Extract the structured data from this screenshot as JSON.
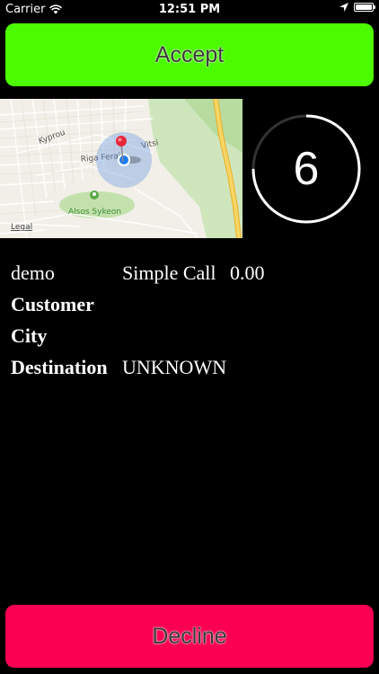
{
  "status_bar": {
    "carrier": "Carrier",
    "time": "12:51 PM",
    "battery_level": 0.9
  },
  "accept_button": {
    "label": "Accept"
  },
  "map": {
    "legal_label": "Legal",
    "street_labels": [
      "Kyprou",
      "Riga Ferai",
      "Vitsi"
    ],
    "park_label": "Alsos Sykeon"
  },
  "countdown": {
    "value": "6",
    "progress": 0.75
  },
  "call": {
    "name": "demo",
    "type": "Simple Call",
    "amount": "0.00",
    "customer_label": "Customer",
    "city_label": "City",
    "destination_label": "Destination",
    "destination_value": "UNKNOWN"
  },
  "decline_button": {
    "label": "Decline"
  },
  "colors": {
    "accept": "#4cfb00",
    "decline": "#fb0052",
    "background": "#000000",
    "map_park": "#b8dba0",
    "map_road_major": "#f5c842"
  }
}
